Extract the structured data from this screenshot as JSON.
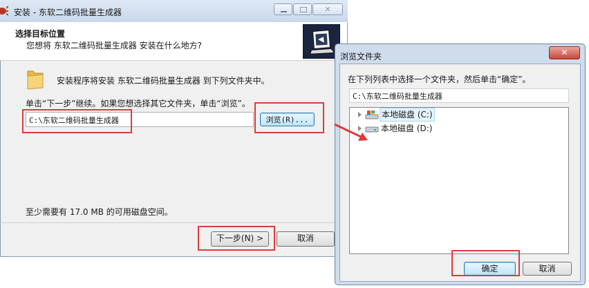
{
  "installer": {
    "title": "安装 - 东软二维码批量生成器",
    "header_title": "选择目标位置",
    "header_subtitle": "您想将 东软二维码批量生成器 安装在什么地方?",
    "intro": "安装程序将安装 东软二维码批量生成器 到下列文件夹中。",
    "hint": "单击“下一步”继续。如果您想选择其它文件夹，单击“浏览”。",
    "path_value": "C:\\东软二维码批量生成器",
    "browse_label": "浏览(R)...",
    "space_text": "至少需要有 17.0 MB 的可用磁盘空间。",
    "next_label": "下一步(N) >",
    "cancel_label": "取消"
  },
  "browse_dialog": {
    "title": "浏览文件夹",
    "instruction": "在下列列表中选择一个文件夹，然后单击“确定”。",
    "path_value": "C:\\东软二维码批量生成器",
    "drives": [
      {
        "label": "本地磁盘 (C:)",
        "icon": "windows-drive-icon",
        "selected": true
      },
      {
        "label": "本地磁盘 (D:)",
        "icon": "hard-drive-icon",
        "selected": false
      }
    ],
    "ok_label": "确定",
    "cancel_label": "取消"
  },
  "colors": {
    "highlight": "#e0393a",
    "dialog_frame": "#cfdcec",
    "close_button": "#c9473a",
    "selection": "#e5f3fb"
  }
}
